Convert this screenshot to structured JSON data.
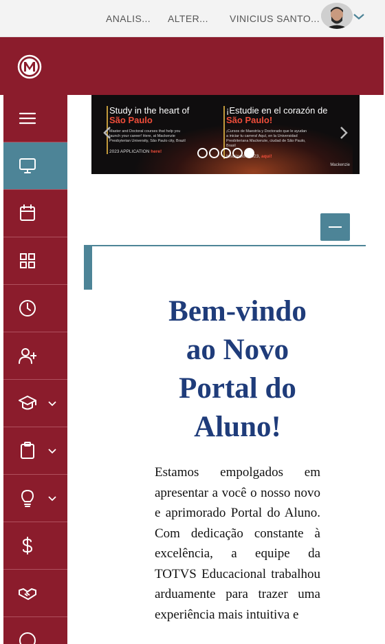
{
  "topnav": {
    "items": [
      "ANALIS...",
      "ALTER...",
      "VINICIUS SANTO..."
    ]
  },
  "brand": {
    "logo": "mackenzie-logo"
  },
  "sidebar": {
    "items": [
      {
        "icon": "menu-icon"
      },
      {
        "icon": "monitor-icon",
        "active": true
      },
      {
        "icon": "calendar-icon"
      },
      {
        "icon": "grid-icon"
      },
      {
        "icon": "clock-icon"
      },
      {
        "icon": "user-plus-icon"
      },
      {
        "icon": "graduation-cap-icon",
        "has_submenu": true
      },
      {
        "icon": "clipboard-icon",
        "has_submenu": true
      },
      {
        "icon": "lightbulb-icon",
        "has_submenu": true
      },
      {
        "icon": "dollar-icon"
      },
      {
        "icon": "handshake-icon"
      },
      {
        "icon": "help-icon"
      }
    ]
  },
  "banner": {
    "en_title": "Study in the heart of",
    "en_city": "São Paulo",
    "en_body": "Master and Doctoral courses that help you launch your career! Here, at Mackenzie Presbyterian University, São Paulo city, Brazil",
    "en_apply": "2023 APPLICATION",
    "en_apply_link": "here!",
    "es_title": "¡Estudie en el corazón de",
    "es_city": "São Paulo!",
    "es_body": "¡Cursos de Maestría y Doctorado que le ayudan a iniciar tu carrera! Aquí, en la Universidad Presbiteriana Mackenzie, ciudad de São Paulo, Brasil",
    "es_apply": "Inscripción 2023,",
    "es_apply_link": "aquí!",
    "brand": "Mackenzie",
    "slide_count": 5,
    "active_slide": 5
  },
  "welcome": {
    "title": "Bem-vindo ao Novo Portal do Aluno!",
    "text": "Estamos empolgados em apresentar a você o nosso novo e aprimorado Portal do Aluno. Com dedicação constante à excelência, a equipe da TOTVS Educacional trabalhou arduamente para trazer uma experiência mais intuitiva e"
  },
  "colors": {
    "brand": "#8b1c2c",
    "accent": "#4d8497",
    "title": "#1f3c7a"
  }
}
